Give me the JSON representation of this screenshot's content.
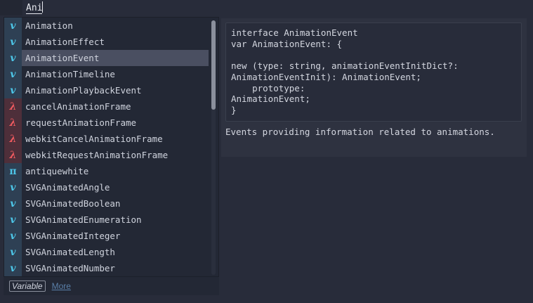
{
  "editor": {
    "typed_text": "Ani"
  },
  "suggestions": {
    "items": [
      {
        "kind": "v",
        "kind_class": "v",
        "label": "Animation"
      },
      {
        "kind": "v",
        "kind_class": "v",
        "label": "AnimationEffect"
      },
      {
        "kind": "v",
        "kind_class": "v",
        "label": "AnimationEvent",
        "selected": true
      },
      {
        "kind": "v",
        "kind_class": "v",
        "label": "AnimationTimeline"
      },
      {
        "kind": "v",
        "kind_class": "v",
        "label": "AnimationPlaybackEvent"
      },
      {
        "kind": "λ",
        "kind_class": "l",
        "label": "cancelAnimationFrame"
      },
      {
        "kind": "λ",
        "kind_class": "l",
        "label": "requestAnimationFrame"
      },
      {
        "kind": "λ",
        "kind_class": "l",
        "label": "webkitCancelAnimationFrame"
      },
      {
        "kind": "λ",
        "kind_class": "l",
        "label": "webkitRequestAnimationFrame"
      },
      {
        "kind": "π",
        "kind_class": "p",
        "label": "antiquewhite"
      },
      {
        "kind": "v",
        "kind_class": "v",
        "label": "SVGAnimatedAngle"
      },
      {
        "kind": "v",
        "kind_class": "v",
        "label": "SVGAnimatedBoolean"
      },
      {
        "kind": "v",
        "kind_class": "v",
        "label": "SVGAnimatedEnumeration"
      },
      {
        "kind": "v",
        "kind_class": "v",
        "label": "SVGAnimatedInteger"
      },
      {
        "kind": "v",
        "kind_class": "v",
        "label": "SVGAnimatedLength"
      },
      {
        "kind": "v",
        "kind_class": "v",
        "label": "SVGAnimatedNumber"
      }
    ],
    "footer": {
      "kind_badge": "Variable",
      "more_link": "More"
    }
  },
  "details": {
    "code": "interface AnimationEvent\nvar AnimationEvent: {\n\nnew (type: string, animationEventInitDict?:\nAnimationEventInit): AnimationEvent;\n    prototype:\nAnimationEvent;\n}",
    "description": "Events providing information related to animations."
  },
  "colors": {
    "background": "#282c3a",
    "variable_icon": "#4dc6e8",
    "function_icon": "#ef5a5f",
    "selected_row": "#4a4f61"
  }
}
